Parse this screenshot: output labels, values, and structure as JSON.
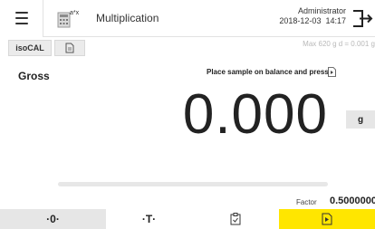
{
  "header": {
    "menu_icon": "hamburger-menu-icon",
    "app_icon": "calculator-exponent-icon",
    "app_icon_glyph": "a*x",
    "title": "Multiplication",
    "user_name": "Administrator",
    "date": "2018-12-03",
    "time": "14:17",
    "logout_icon": "logout-arrow-icon"
  },
  "toolbar": {
    "iscal_label": "isoCAL",
    "report_icon": "document-list-icon",
    "specs": "Max 620 g  d = 0.001 g"
  },
  "main": {
    "mode_label": "Gross",
    "instruction": "Place sample on balance and press",
    "weight_value": "0.000",
    "unit": "g",
    "progress_fraction": 0,
    "factor_label": "Factor",
    "factor_value": "0.5000000"
  },
  "bottom_bar": {
    "zero_label": "·0·",
    "tare_label": "·T·",
    "store_icon": "clipboard-check-icon",
    "start_icon": "document-play-icon"
  },
  "colors": {
    "accent": "#ffe600",
    "key_bg": "#e6e6e6"
  }
}
